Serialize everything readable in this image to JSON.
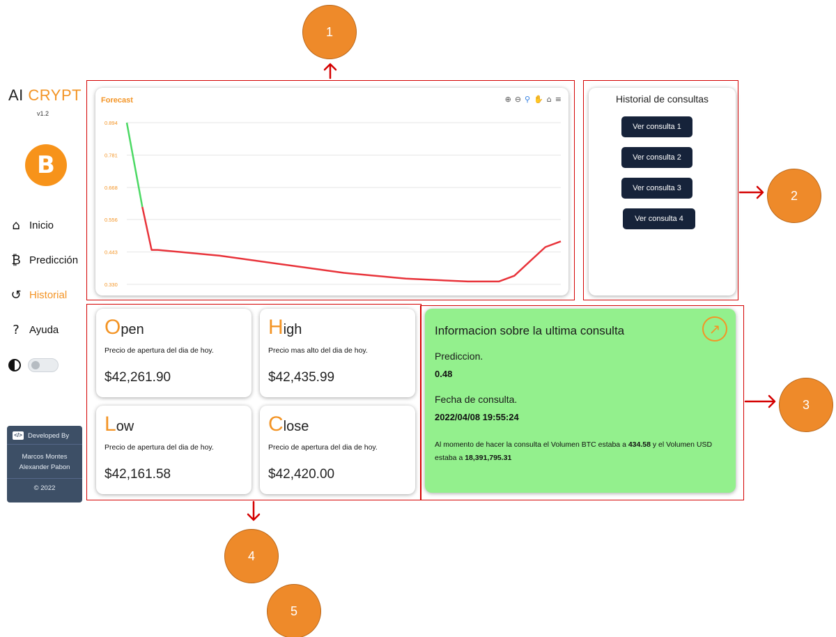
{
  "sidebar": {
    "brand_left": "AI",
    "brand_right": "CRYPT",
    "version": "v1.2",
    "logo_glyph": "B",
    "items": [
      {
        "label": "Inicio",
        "icon": "home-icon",
        "glyph": "⌂",
        "active": false
      },
      {
        "label": "Predicción",
        "icon": "bitcoin-icon",
        "glyph": "₿",
        "active": false
      },
      {
        "label": "Historial",
        "icon": "history-icon",
        "glyph": "↺",
        "active": true
      },
      {
        "label": "Ayuda",
        "icon": "help-icon",
        "glyph": "?",
        "active": false
      }
    ],
    "developer": {
      "header": "Developed By",
      "names": [
        "Marcos Montes",
        "Alexander Pabon"
      ],
      "year": "© 2022"
    }
  },
  "chart": {
    "title": "Forecast",
    "toolbar": [
      "⊕",
      "⊖",
      "⚲",
      "✋",
      "⌂",
      "≡"
    ]
  },
  "chart_data": {
    "type": "line",
    "title": "Forecast",
    "yticks": [
      "0.894",
      "0.781",
      "0.668",
      "0.556",
      "0.443",
      "0.330"
    ],
    "ylim": [
      0.33,
      0.894
    ],
    "grid": true,
    "series": [
      {
        "color": "#4cd964",
        "x": [
          0,
          0.5
        ],
        "y": [
          0.894,
          0.6
        ]
      },
      {
        "color": "#e8333a",
        "x": [
          0.5,
          0.8,
          1,
          3,
          5,
          7,
          9,
          11,
          12,
          12.5,
          13,
          13.5,
          14
        ],
        "y": [
          0.6,
          0.45,
          0.45,
          0.43,
          0.4,
          0.37,
          0.35,
          0.34,
          0.34,
          0.36,
          0.41,
          0.46,
          0.48
        ]
      }
    ]
  },
  "history": {
    "title": "Historial de consultas",
    "buttons": [
      "Ver consulta 1",
      "Ver consulta 2",
      "Ver consulta 3",
      "Ver consulta 4"
    ]
  },
  "stats": [
    {
      "letter": "O",
      "rest": "pen",
      "desc": "Precio de apertura del dia de hoy.",
      "value": "$42,261.90"
    },
    {
      "letter": "H",
      "rest": "igh",
      "desc": "Precio mas alto del dia de hoy.",
      "value": "$42,435.99"
    },
    {
      "letter": "L",
      "rest": "ow",
      "desc": "Precio de apertura del dia de hoy.",
      "value": "$42,161.58"
    },
    {
      "letter": "C",
      "rest": "lose",
      "desc": "Precio de apertura del dia de hoy.",
      "value": "$42,420.00"
    }
  ],
  "info": {
    "title": "Informacion sobre la ultima consulta",
    "prediction_label": "Prediccion.",
    "prediction_value": "0.48",
    "date_label": "Fecha de consulta.",
    "date_value": "2022/04/08 19:55:24",
    "note_a": "Al momento de hacer la consulta el Volumen BTC estaba a ",
    "btc_volume": "434.58",
    "note_b": " y el Volumen USD estaba a ",
    "usd_volume": "18,391,795.31",
    "arrow_glyph": "↗"
  },
  "callouts": [
    "1",
    "2",
    "3",
    "4",
    "5"
  ],
  "colors": {
    "accent": "#f39425",
    "info_bg": "#93f08d",
    "button_bg": "#16233a",
    "annotation": "#d40000",
    "callout": "#ee8a2a"
  }
}
